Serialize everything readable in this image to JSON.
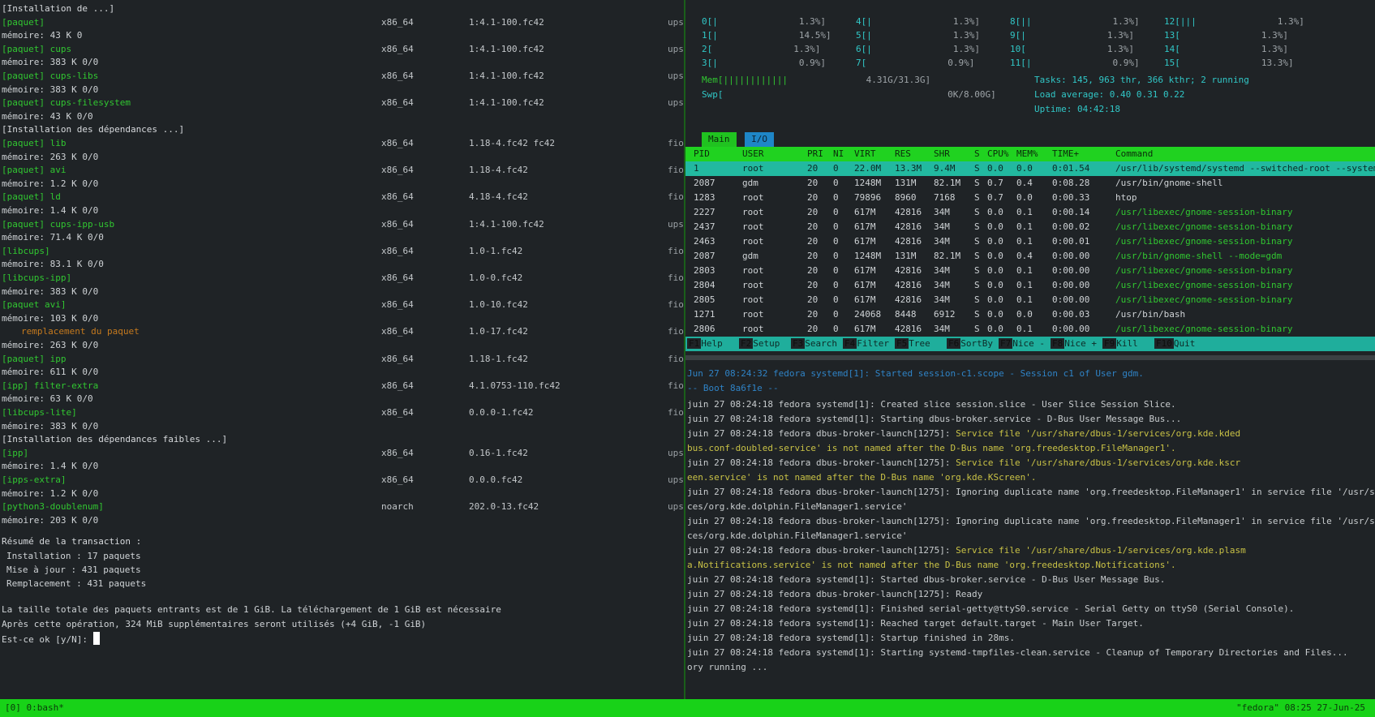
{
  "left_pane": {
    "rows": [
      {
        "c1": "[Installation de ...]",
        "kind": "head"
      },
      {
        "c1": "[paquet]",
        "kind": "pkg",
        "c2": "x86_64",
        "c3": "1:4.1-100.fc42",
        "c4": "ups"
      },
      {
        "c1": "mémoire: 43 K  0",
        "kind": "stat"
      },
      {
        "c1": "[paquet] cups",
        "kind": "pkg",
        "c2": "x86_64",
        "c3": "1:4.1-100.fc42",
        "c4": "ups"
      },
      {
        "c1": "mémoire: 383 K 0/0",
        "kind": "stat"
      },
      {
        "c1": "[paquet] cups-libs",
        "kind": "pkg",
        "c2": "x86_64",
        "c3": "1:4.1-100.fc42",
        "c4": "ups"
      },
      {
        "c1": "mémoire: 383 K 0/0",
        "kind": "stat"
      },
      {
        "c1": "[paquet] cups-filesystem",
        "kind": "pkg",
        "c2": "x86_64",
        "c3": "1:4.1-100.fc42",
        "c4": "ups"
      },
      {
        "c1": "mémoire: 43 K 0/0",
        "kind": "stat"
      },
      {
        "c1": "[Installation des dépendances ...]",
        "kind": "head"
      },
      {
        "c1": "[paquet] lib",
        "kind": "pkg",
        "c2": "x86_64",
        "c3": "1.18-4.fc42 fc42",
        "c4": "fio"
      },
      {
        "c1": "mémoire: 263 K 0/0",
        "kind": "stat"
      },
      {
        "c1": "[paquet] avi",
        "kind": "pkg",
        "c2": "x86_64",
        "c3": "1.18-4.fc42",
        "c4": "fio"
      },
      {
        "c1": "mémoire: 1.2 K 0/0",
        "kind": "stat"
      },
      {
        "c1": "[paquet] ld",
        "kind": "pkg",
        "c2": "x86_64",
        "c3": "4.18-4.fc42",
        "c4": "fio"
      },
      {
        "c1": "mémoire: 1.4 K 0/0",
        "kind": "stat"
      },
      {
        "c1": "[paquet] cups-ipp-usb",
        "kind": "pkg",
        "c2": "x86_64",
        "c3": "1:4.1-100.fc42",
        "c4": "ups"
      },
      {
        "c1": "mémoire: 71.4 K 0/0",
        "kind": "stat"
      },
      {
        "c1": "[libcups]",
        "kind": "pkg",
        "c2": "x86_64",
        "c3": "1.0-1.fc42",
        "c4": "fio"
      },
      {
        "c1": "mémoire: 83.1 K 0/0",
        "kind": "stat"
      },
      {
        "c1": "[libcups-ipp]",
        "kind": "pkg",
        "c2": "x86_64",
        "c3": "1.0-0.fc42",
        "c4": "fio"
      },
      {
        "c1": "mémoire: 383 K 0/0",
        "kind": "stat"
      },
      {
        "c1": "[paquet avi]",
        "kind": "pkg",
        "c2": "x86_64",
        "c3": "1.0-10.fc42",
        "c4": "fio"
      },
      {
        "c1": "mémoire: 103 K 0/0",
        "kind": "stat"
      },
      {
        "c1": "remplacement du paquet",
        "kind": "warn",
        "c2": "x86_64",
        "c3": "1.0-17.fc42",
        "c4": "fio"
      },
      {
        "c1": "mémoire: 263 K 0/0",
        "kind": "stat"
      },
      {
        "c1": "[paquet] ipp",
        "kind": "pkg",
        "c2": "x86_64",
        "c3": "1.18-1.fc42",
        "c4": "fio"
      },
      {
        "c1": "mémoire: 611 K 0/0",
        "kind": "stat"
      },
      {
        "c1": "[ipp] filter-extra",
        "kind": "pkg",
        "c2": "x86_64",
        "c3": "4.1.0753-110.fc42",
        "c4": "fio"
      },
      {
        "c1": "mémoire: 63 K 0/0",
        "kind": "stat"
      },
      {
        "c1": "[libcups-lite]",
        "kind": "pkg",
        "c2": "x86_64",
        "c3": "0.0.0-1.fc42",
        "c4": "fio"
      },
      {
        "c1": "mémoire: 383 K 0/0",
        "kind": "stat"
      },
      {
        "c1": "[Installation des dépendances faibles ...]",
        "kind": "head"
      },
      {
        "c1": "[ipp]",
        "kind": "pkg",
        "c2": "x86_64",
        "c3": "0.16-1.fc42",
        "c4": "ups"
      },
      {
        "c1": "mémoire: 1.4 K 0/0",
        "kind": "stat"
      },
      {
        "c1": "[ipps-extra]",
        "kind": "pkg",
        "c2": "x86_64",
        "c3": "0.0.0.fc42",
        "c4": "ups"
      },
      {
        "c1": "mémoire: 1.2 K 0/0",
        "kind": "stat"
      },
      {
        "c1": "[python3-doublenum]",
        "kind": "pkg",
        "c2": "noarch",
        "c3": "202.0-13.fc42",
        "c4": "ups"
      },
      {
        "c1": "mémoire: 203 K 0/0",
        "kind": "stat"
      }
    ],
    "summary_title": "Résumé de la transaction :",
    "summary_lines": [
      "Installation :        17 paquets",
      "Mise à jour :        431 paquets",
      "Remplacement :       431 paquets"
    ],
    "size_text_1": "La taille totale des paquets entrants est de 1 GiB. La téléchargement de 1 GiB est nécessaire",
    "size_text_2": "Après cette opération, 324 MiB supplémentaires seront utilisés (+4 GiB, -1 GiB)",
    "prompt": "Est-ce ok [y/N]: "
  },
  "htop": {
    "meters": [
      {
        "label": "0[|",
        "val": "1.3%]",
        "label2": "4[|",
        "val2": "1.3%]",
        "label3": "8[||",
        "val3": "1.3%]",
        "label4": "12[|||",
        "val4": "1.3%]"
      },
      {
        "label": "1[|",
        "val": "14.5%]",
        "label2": "5[|",
        "val2": "1.3%]",
        "label3": "9[|",
        "val3": "1.3%]",
        "label4": "13[",
        "val4": "1.3%]"
      },
      {
        "label": "2[",
        "val": "1.3%]",
        "label2": "6[|",
        "val2": "1.3%]",
        "label3": "10[",
        "val3": "1.3%]",
        "label4": "14[",
        "val4": "1.3%]"
      },
      {
        "label": "3[|",
        "val": "0.9%]",
        "label2": "7[",
        "val2": "0.9%]",
        "label3": "11[|",
        "val3": "0.9%]",
        "label4": "15[",
        "val4": "13.3%]"
      }
    ],
    "mem_label": "Mem[||||||||||||",
    "mem_val": "4.31G/31.3G]",
    "swp_label": "Swp[",
    "swp_val": "0K/8.00G]",
    "tasks": "Tasks: 145, 963 thr, 366 kthr; 2 running",
    "load": "Load average: 0.40 0.31 0.22",
    "uptime": "Uptime: 04:42:18",
    "tabs": [
      "Main",
      "I/O"
    ],
    "header_cols": [
      "PID",
      "USER",
      "PRI",
      "NI",
      "VIRT",
      "RES",
      "SHR",
      "S",
      "CPU%",
      "MEM%",
      "TIME+",
      "Command"
    ],
    "selected": [
      "1",
      "root",
      "20",
      "0",
      "22.0M",
      "13.3M",
      "9.4M",
      "S",
      "0.0",
      "0.0",
      "0:01.54",
      "/usr/lib/systemd/systemd --switched-root --system"
    ],
    "processes": [
      [
        "2087",
        "gdm",
        "20",
        "0",
        "1248M",
        "131M",
        "82.1M",
        "S",
        "0.7",
        "0.4",
        "0:08.28",
        "/usr/bin/gnome-shell",
        ""
      ],
      [
        "1283",
        "root",
        "20",
        "0",
        "79896",
        "8960",
        "7168",
        "S",
        "0.7",
        "0.0",
        "0:00.33",
        "htop",
        ""
      ],
      [
        "2227",
        "root",
        "20",
        "0",
        "617M",
        "42816",
        "34M",
        "S",
        "0.0",
        "0.1",
        "0:00.14",
        "/usr/libexec/gnome-session-binary",
        "g"
      ],
      [
        "2437",
        "root",
        "20",
        "0",
        "617M",
        "42816",
        "34M",
        "S",
        "0.0",
        "0.1",
        "0:00.02",
        "/usr/libexec/gnome-session-binary",
        "g"
      ],
      [
        "2463",
        "root",
        "20",
        "0",
        "617M",
        "42816",
        "34M",
        "S",
        "0.0",
        "0.1",
        "0:00.01",
        "/usr/libexec/gnome-session-binary",
        "g"
      ],
      [
        "2087",
        "gdm",
        "20",
        "0",
        "1248M",
        "131M",
        "82.1M",
        "S",
        "0.0",
        "0.4",
        "0:00.00",
        "/usr/bin/gnome-shell --mode=gdm",
        "g"
      ],
      [
        "2803",
        "root",
        "20",
        "0",
        "617M",
        "42816",
        "34M",
        "S",
        "0.0",
        "0.1",
        "0:00.00",
        "/usr/libexec/gnome-session-binary",
        "g"
      ],
      [
        "2804",
        "root",
        "20",
        "0",
        "617M",
        "42816",
        "34M",
        "S",
        "0.0",
        "0.1",
        "0:00.00",
        "/usr/libexec/gnome-session-binary",
        "g"
      ],
      [
        "2805",
        "root",
        "20",
        "0",
        "617M",
        "42816",
        "34M",
        "S",
        "0.0",
        "0.1",
        "0:00.00",
        "/usr/libexec/gnome-session-binary",
        "g"
      ],
      [
        "1271",
        "root",
        "20",
        "0",
        "24068",
        "8448",
        "6912",
        "S",
        "0.0",
        "0.0",
        "0:00.03",
        "/usr/bin/bash",
        ""
      ],
      [
        "2806",
        "root",
        "20",
        "0",
        "617M",
        "42816",
        "34M",
        "S",
        "0.0",
        "0.1",
        "0:00.00",
        "/usr/libexec/gnome-session-binary",
        "g"
      ]
    ],
    "fkeys": [
      {
        "k": "F1",
        "l": "Help"
      },
      {
        "k": "F2",
        "l": "Setup"
      },
      {
        "k": "F3",
        "l": "Search"
      },
      {
        "k": "F4",
        "l": "Filter"
      },
      {
        "k": "F5",
        "l": "Tree"
      },
      {
        "k": "F6",
        "l": "SortBy"
      },
      {
        "k": "F7",
        "l": "Nice -"
      },
      {
        "k": "F8",
        "l": "Nice +"
      },
      {
        "k": "F9",
        "l": "Kill"
      },
      {
        "k": "F10",
        "l": "Quit"
      }
    ]
  },
  "journal": {
    "header": "Jun 27 08:24:32 fedora systemd[1]: Started session-c1.scope - Session c1 of User gdm.",
    "subheader": "-- Boot 8a6f1e --",
    "lines": [
      {
        "t": "juin 27 08:24:18 fedora systemd[1]: Created slice session.slice - User Slice Session Slice.",
        "y": ""
      },
      {
        "t": "juin 27 08:24:18 fedora systemd[1]: Starting dbus-broker.service - D-Bus User Message Bus...",
        "y": ""
      },
      {
        "t": "juin 27 08:24:18 fedora dbus-broker-launch[1275]: ",
        "y": "Service file '/usr/share/dbus-1/services/org.kde.kded"
      },
      {
        "t": "",
        "y": "bus.conf-doubled-service' is not named after the D-Bus name 'org.freedesktop.FileManager1'."
      },
      {
        "t": "juin 27 08:24:18 fedora dbus-broker-launch[1275]: ",
        "y": "Service file '/usr/share/dbus-1/services/org.kde.kscr"
      },
      {
        "t": "",
        "y": "een.service' is not named after the D-Bus name 'org.kde.KScreen'."
      },
      {
        "t": "juin 27 08:24:18 fedora dbus-broker-launch[1275]: Ignoring duplicate name 'org.freedesktop.FileManager1' in service file '/usr/share/dbus-1/servi",
        "y": ""
      },
      {
        "t": "ces/org.kde.dolphin.FileManager1.service'",
        "y": ""
      },
      {
        "t": "juin 27 08:24:18 fedora dbus-broker-launch[1275]: Ignoring duplicate name 'org.freedesktop.FileManager1' in service file '/usr/share/dbus-1/servi",
        "y": ""
      },
      {
        "t": "ces/org.kde.dolphin.FileManager1.service'",
        "y": ""
      },
      {
        "t": "juin 27 08:24:18 fedora dbus-broker-launch[1275]: ",
        "y": "Service file '/usr/share/dbus-1/services/org.kde.plasm"
      },
      {
        "t": "",
        "y": "a.Notifications.service' is not named after the D-Bus name 'org.freedesktop.Notifications'."
      },
      {
        "t": "juin 27 08:24:18 fedora systemd[1]: Started dbus-broker.service - D-Bus User Message Bus.",
        "y": ""
      },
      {
        "t": "juin 27 08:24:18 fedora dbus-broker-launch[1275]: Ready",
        "y": ""
      },
      {
        "t": "juin 27 08:24:18 fedora systemd[1]: Finished serial-getty@ttyS0.service - Serial Getty on ttyS0 (Serial Console).",
        "y": ""
      },
      {
        "t": "juin 27 08:24:18 fedora systemd[1]: Reached target default.target - Main User Target.",
        "y": ""
      },
      {
        "t": "juin 27 08:24:18 fedora systemd[1]: Startup finished in 28ms.",
        "y": ""
      },
      {
        "t": "juin 27 08:24:18 fedora systemd[1]: Starting systemd-tmpfiles-clean.service - Cleanup of Temporary Directories and Files...",
        "y": ""
      },
      {
        "t": "ory running ...",
        "y": ""
      }
    ]
  },
  "status": {
    "left": "[0] 0:bash*",
    "right": "\"fedora\" 08:25 27-Jun-25"
  },
  "colors": {
    "accent_green": "#18d218",
    "teal": "#22b9a0",
    "blue": "#2f83c6",
    "yellow": "#c9c246",
    "orange": "#c57a1e"
  }
}
